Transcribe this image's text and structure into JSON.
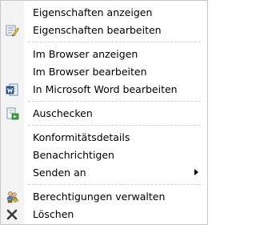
{
  "menu": {
    "items": [
      {
        "label": "Eigenschaften anzeigen",
        "icon": null
      },
      {
        "label": "Eigenschaften bearbeiten",
        "icon": "edit-properties-icon"
      },
      {
        "label": "Im Browser anzeigen",
        "icon": null
      },
      {
        "label": "Im Browser bearbeiten",
        "icon": null
      },
      {
        "label": "In Microsoft Word bearbeiten",
        "icon": "word-document-icon"
      },
      {
        "label": "Auschecken",
        "icon": "check-out-icon"
      },
      {
        "label": "Konformitätsdetails",
        "icon": null
      },
      {
        "label": "Benachrichtigen",
        "icon": null
      },
      {
        "label": "Senden an",
        "icon": null,
        "submenu": true
      },
      {
        "label": "Berechtigungen verwalten",
        "icon": "permissions-icon"
      },
      {
        "label": "Löschen",
        "icon": "delete-icon"
      }
    ]
  },
  "colors": {
    "gutter": "#f3f3f3",
    "border": "#c6c6c6",
    "separator": "#d4d4d4",
    "text": "#000000"
  }
}
